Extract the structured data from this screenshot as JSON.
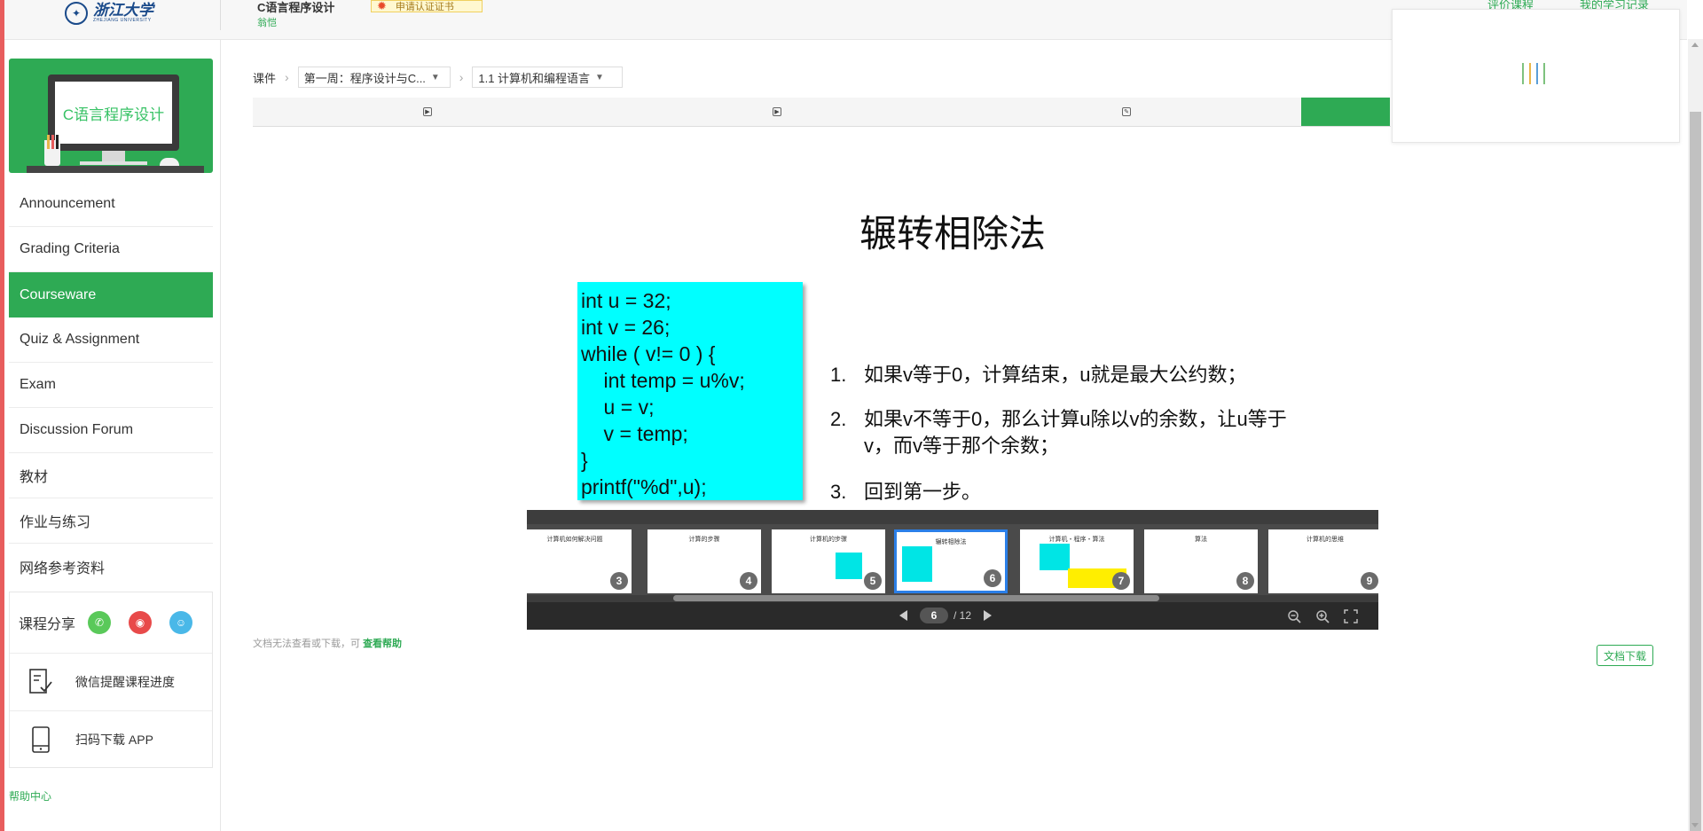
{
  "header": {
    "logo_text": "浙江大学",
    "logo_sub": "ZHEJIANG UNIVERSITY",
    "course_title": "C语言程序设计",
    "course_school": "翁恺",
    "cert_badge": "申请认证证书",
    "link_evaluate": "评价课程",
    "link_learning": "我的学习记录"
  },
  "course_card": {
    "screen_text": "C语言程序设计"
  },
  "sidebar": {
    "items": [
      {
        "label": "Announcement"
      },
      {
        "label": "Grading Criteria"
      },
      {
        "label": "Courseware",
        "active": true
      },
      {
        "label": "Quiz & Assignment"
      },
      {
        "label": "Exam"
      },
      {
        "label": "Discussion Forum"
      },
      {
        "label": "教材"
      },
      {
        "label": "作业与练习"
      },
      {
        "label": "网络参考资料"
      }
    ],
    "share_label": "课程分享",
    "share_icons": [
      "wechat-icon",
      "weibo-icon",
      "qq-icon"
    ],
    "wechat_remind": "微信提醒课程进度",
    "scan_app": "扫码下载 APP",
    "help_center": "帮助中心"
  },
  "breadcrumb": {
    "root": "课件",
    "week": "第一周：程序设计与C...",
    "lesson": "1.1 计算机和编程语言"
  },
  "slide": {
    "title": "辗转相除法",
    "code": [
      "int u = 32;",
      "int v = 26;",
      "while ( v!= 0 ) {",
      "    int temp = u%v;",
      "    u = v;",
      "    v = temp;",
      "}",
      "printf(\"%d\",u);"
    ],
    "steps": [
      {
        "num": "1.",
        "text": "如果v等于0，计算结束，u就是最大公约数；"
      },
      {
        "num": "2.",
        "text": "如果v不等于0，那么计算u除以v的余数，让u等于v，而v等于那个余数；"
      },
      {
        "num": "3.",
        "text": "回到第一步。"
      }
    ]
  },
  "viewer": {
    "thumbs": [
      {
        "num": "3",
        "title": "计算机如何解决问题"
      },
      {
        "num": "4",
        "title": "计算的步骤"
      },
      {
        "num": "5",
        "title": "计算机的步骤"
      },
      {
        "num": "6",
        "title": "辗转相除法",
        "active": true
      },
      {
        "num": "7",
        "title": "计算机・程序・算法"
      },
      {
        "num": "8",
        "title": "算法"
      },
      {
        "num": "9",
        "title": "计算机的思维"
      }
    ],
    "current_page": "6",
    "total_pages": "/ 12",
    "colors": {
      "accent": "#2eaa54",
      "thumb_active": "#2b7fe8",
      "code_bg": "#00ffff"
    }
  },
  "footer_note": {
    "text": "文档无法查看或下载，可",
    "link": "查看帮助"
  },
  "download_button": "文档下载"
}
